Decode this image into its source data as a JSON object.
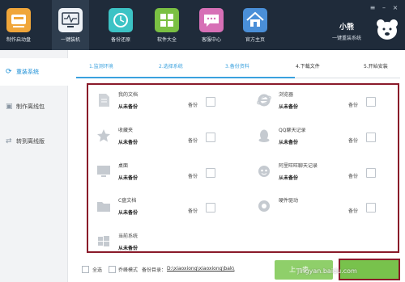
{
  "toolbar": [
    {
      "name": "usb-boot",
      "label": "制作启动盘"
    },
    {
      "name": "reinstall",
      "label": "一键装机",
      "active": true
    },
    {
      "name": "backup-restore",
      "label": "备份还原"
    },
    {
      "name": "software",
      "label": "软件大全"
    },
    {
      "name": "service",
      "label": "客服中心"
    },
    {
      "name": "homepage",
      "label": "官方主页"
    }
  ],
  "brand": {
    "name": "小熊",
    "tagline": "一键重装系统"
  },
  "sidebar": [
    {
      "label": "重装系统",
      "icon": "refresh-icon",
      "active": true
    },
    {
      "label": "制作离线包",
      "icon": "package-icon"
    },
    {
      "label": "转到离线版",
      "icon": "switch-icon"
    }
  ],
  "steps": [
    "1.监测环境",
    "2.选择系统",
    "3.备份资料",
    "4.下载文件",
    "5.开始安装"
  ],
  "current_step": 4,
  "backup_label": "备份",
  "status_never": "从未备份",
  "items": [
    {
      "name": "我的文档",
      "status": "从未备份",
      "icon": "document-icon"
    },
    {
      "name": "浏览器",
      "status": "从未备份",
      "icon": "ie-icon"
    },
    {
      "name": "收藏夹",
      "status": "从未备份",
      "icon": "star-icon"
    },
    {
      "name": "QQ聊天记录",
      "status": "从未备份",
      "icon": "qq-icon"
    },
    {
      "name": "桌面",
      "status": "从未备份",
      "icon": "monitor-icon"
    },
    {
      "name": "阿里旺旺聊天记录",
      "status": "从未备份",
      "icon": "wangwang-icon"
    },
    {
      "name": "C盘文档",
      "status": "从未备份",
      "icon": "folder-icon"
    },
    {
      "name": "硬件驱动",
      "status": "",
      "icon": "driver-icon"
    },
    {
      "name": "当前系统",
      "status": "从未备份",
      "icon": "windows-icon"
    }
  ],
  "footer": {
    "select_all": "全选",
    "fast_mode": "乔峰模式",
    "dir_label": "备份目录：",
    "dir_path": "D:\\xiaoxiong\\xiaoxiong\\bak\\",
    "prev": "上一步",
    "next": ""
  },
  "watermark": "jingyan.baidu.com",
  "colors": {
    "accent": "#3aa1de",
    "highlight": "#8a1a2a",
    "green": "#78c24c",
    "header": "#1f2b3a"
  }
}
